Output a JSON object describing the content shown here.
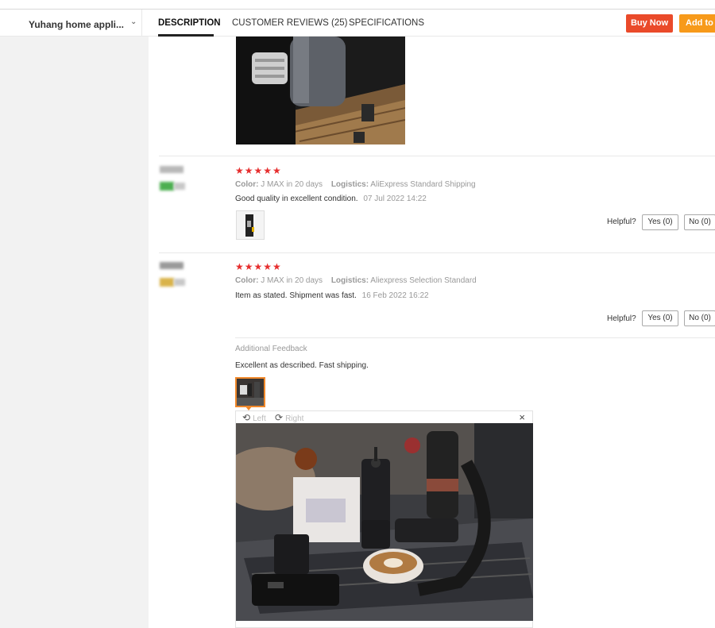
{
  "nav": {
    "store_name": "Yuhang home appli...",
    "tabs": [
      "DESCRIPTION",
      "CUSTOMER REVIEWS (25)",
      "SPECIFICATIONS"
    ],
    "buy_now": "Buy Now",
    "add_to_cart": "Add to C"
  },
  "reviews": [
    {
      "stars": "★★★★★",
      "color_label": "Color:",
      "color_value": "J MAX in 20 days",
      "logistics_label": "Logistics:",
      "logistics_value": "AliExpress Standard Shipping",
      "text": "Good quality in excellent condition.",
      "date": "07 Jul 2022 14:22",
      "helpful": "Helpful?",
      "yes": "Yes (0)",
      "no": "No (0)"
    },
    {
      "stars": "★★★★★",
      "color_label": "Color:",
      "color_value": "J MAX in 20 days",
      "logistics_label": "Logistics:",
      "logistics_value": "Aliexpress Selection Standard",
      "text": "Item as stated. Shipment was fast.",
      "date": "16 Feb 2022 16:22",
      "helpful": "Helpful?",
      "yes": "Yes (0)",
      "no": "No (0)",
      "additional_title": "Additional Feedback",
      "additional_text": "Excellent as described. Fast shipping."
    }
  ],
  "viewer": {
    "rotate_left": "Left",
    "rotate_right": "Right",
    "close": "×"
  },
  "icons": {
    "chevron": "⌄",
    "rotate_left": "⟲",
    "rotate_right": "⟳"
  },
  "colors": {
    "buy_now": "#ea4a2a",
    "add_to_cart": "#f79a1a",
    "stars": "#e62e2e",
    "selected_thumb": "#f0882a"
  }
}
